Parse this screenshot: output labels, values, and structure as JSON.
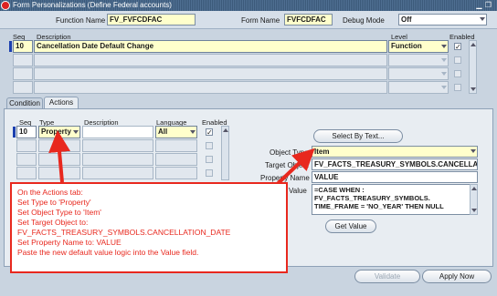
{
  "window": {
    "title": "Form Personalizations (Define Federal accounts)"
  },
  "header": {
    "function_name_label": "Function Name",
    "function_name_value": "FV_FVFCDFAC",
    "form_name_label": "Form Name",
    "form_name_value": "FVFCDFAC",
    "debug_mode_label": "Debug Mode",
    "debug_mode_value": "Off"
  },
  "rules_grid": {
    "columns": {
      "seq": "Seq",
      "description": "Description",
      "level": "Level",
      "enabled": "Enabled"
    },
    "rows": [
      {
        "seq": "10",
        "description": "Cancellation Date Default Change",
        "level": "Function",
        "enabled": "✓"
      }
    ]
  },
  "tabs": [
    {
      "label": "Condition"
    },
    {
      "label": "Actions"
    }
  ],
  "actions_grid": {
    "columns": {
      "seq": "Seq",
      "type": "Type",
      "description": "Description",
      "language": "Language",
      "enabled": "Enabled"
    },
    "rows": [
      {
        "seq": "10",
        "type": "Property",
        "description": "",
        "language": "All",
        "enabled": "✓"
      }
    ]
  },
  "properties": {
    "select_by_text_button": "Select By Text...",
    "object_type_label": "Object Type",
    "object_type_value": "Item",
    "target_object_label": "Target Object",
    "target_object_value": "FV_FACTS_TREASURY_SYMBOLS.CANCELLATI",
    "property_name_label": "Property Name",
    "property_name_value": "VALUE",
    "value_label": "Value",
    "value_lines": [
      "=CASE WHEN :",
      "FV_FACTS_TREASURY_SYMBOLS.",
      "TIME_FRAME = 'NO_YEAR' THEN NULL"
    ],
    "get_value_button": "Get Value"
  },
  "footer": {
    "validate_button": "Validate",
    "apply_now_button": "Apply Now"
  },
  "annotation": {
    "lines": [
      "On the Actions tab:",
      "Set Type to 'Property'",
      "Set Object Type to 'Item'",
      "Set Target Object to:",
      "FV_FACTS_TREASURY_SYMBOLS.CANCELLATION_DATE",
      "Set Property Name to: VALUE",
      "Paste the new default value logic into the Value field."
    ],
    "color": "#e8281e"
  }
}
